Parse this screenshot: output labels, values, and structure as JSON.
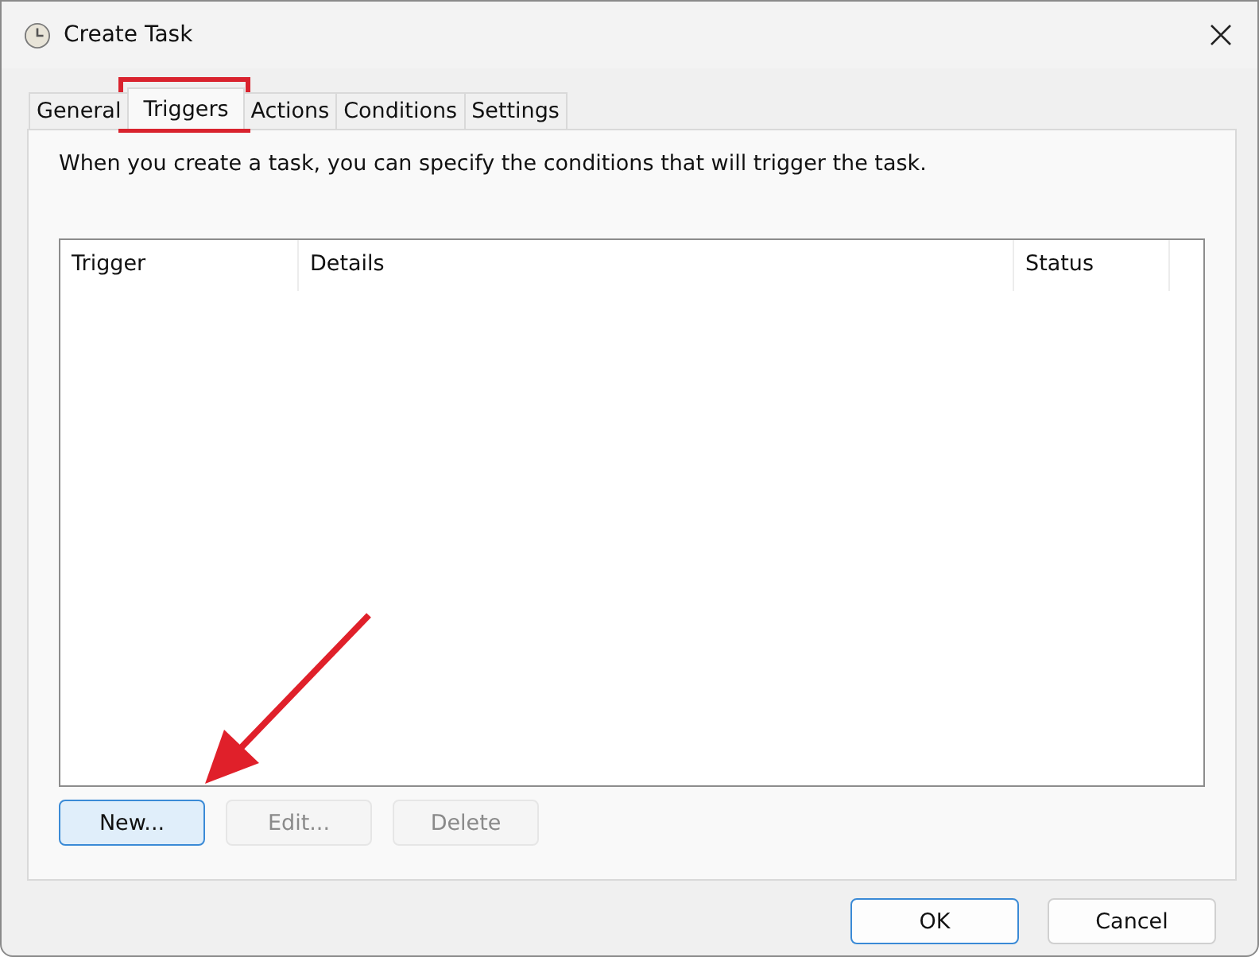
{
  "window": {
    "title": "Create Task"
  },
  "tabs": [
    {
      "label": "General",
      "selected": false
    },
    {
      "label": "Triggers",
      "selected": true
    },
    {
      "label": "Actions",
      "selected": false
    },
    {
      "label": "Conditions",
      "selected": false
    },
    {
      "label": "Settings",
      "selected": false
    }
  ],
  "description": "When you create a task, you can specify the conditions that will trigger the task.",
  "table": {
    "columns": [
      "Trigger",
      "Details",
      "Status"
    ]
  },
  "list_buttons": [
    {
      "label": "New...",
      "disabled": false,
      "focused": true
    },
    {
      "label": "Edit...",
      "disabled": true,
      "focused": false
    },
    {
      "label": "Delete",
      "disabled": true,
      "focused": false
    }
  ],
  "dialog_buttons": [
    {
      "label": "OK",
      "default": true
    },
    {
      "label": "Cancel",
      "default": false
    }
  ]
}
